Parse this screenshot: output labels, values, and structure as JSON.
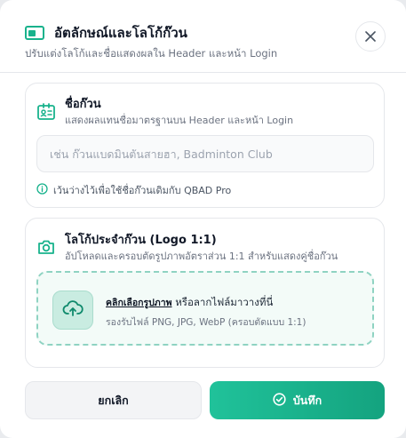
{
  "header": {
    "title": "อัตลักษณ์และโลโก้ก๊วน",
    "subtitle": "ปรับแต่งโลโก้และชื่อแสดงผลใน Header และหน้า Login",
    "icon": "picture-frame-icon",
    "close_icon": "close-icon"
  },
  "club_name": {
    "icon": "id-card-icon",
    "title": "ชื่อก๊วน",
    "description": "แสดงผลแทนชื่อมาตรฐานบน Header และหน้า Login",
    "input_value": "",
    "input_placeholder": "เช่น ก๊วนแบดมินตันสายฮา, Badminton Club",
    "hint": "เว้นว่างไว้เพื่อใช้ชื่อก๊วนเดิมกับ QBAD Pro",
    "hint_icon": "info-icon"
  },
  "club_logo": {
    "icon": "camera-icon",
    "title": "โลโก้ประจำก๊วน (Logo 1:1)",
    "description": "อัปโหลดและครอบตัดรูปภาพอัตราส่วน 1:1 สำหรับแสดงคู่ชื่อก๊วน",
    "upload_icon": "cloud-upload-icon",
    "choose_link": "คลิกเลือกรูปภาพ",
    "drop_text": " หรือลากไฟล์มาวางที่นี่",
    "formats": "รองรับไฟล์ PNG, JPG, WebP (ครอบตัดแบบ 1:1)"
  },
  "footer": {
    "cancel_label": "ยกเลิก",
    "save_label": "บันทึก",
    "save_icon": "check-circle-icon"
  },
  "colors": {
    "accent": "#18b28c",
    "accent_dark": "#14a37f",
    "dropzone_border": "#8fd3c2"
  }
}
